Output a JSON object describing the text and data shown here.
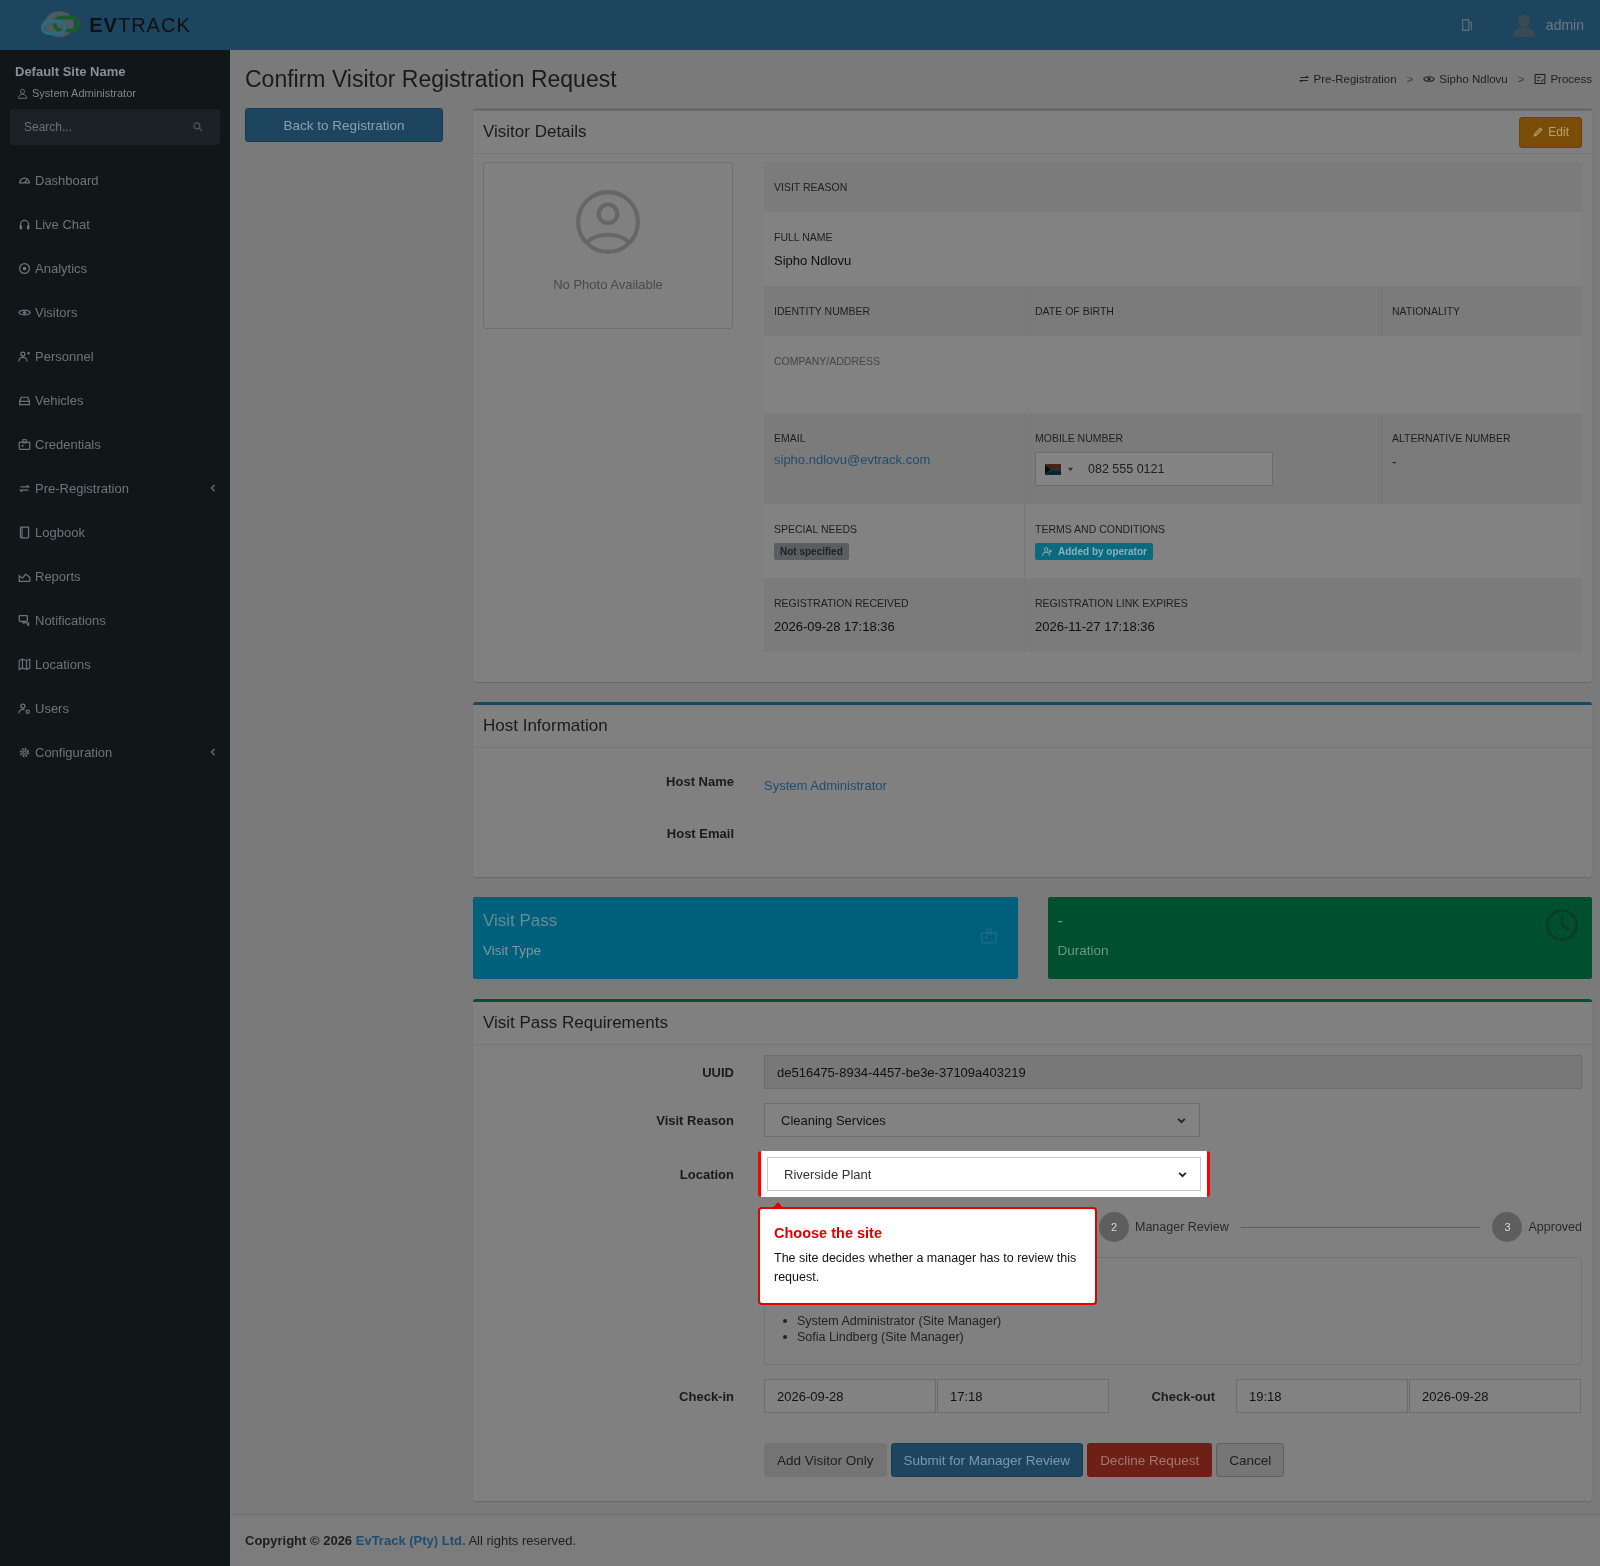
{
  "brand": {
    "logo": "**EV**TRACK"
  },
  "topbar": {
    "user": "admin"
  },
  "sidebar": {
    "site": "Default Site Name",
    "role": "System Administrator",
    "search": {
      "placeholder": "Search..."
    },
    "items": [
      {
        "label": "Dashboard",
        "expandable": false
      },
      {
        "label": "Live Chat",
        "expandable": false
      },
      {
        "label": "Analytics",
        "expandable": false
      },
      {
        "label": "Visitors",
        "expandable": false
      },
      {
        "label": "Personnel",
        "expandable": false
      },
      {
        "label": "Vehicles",
        "expandable": false
      },
      {
        "label": "Credentials",
        "expandable": false
      },
      {
        "label": "Pre-Registration",
        "expandable": true
      },
      {
        "label": "Logbook",
        "expandable": false
      },
      {
        "label": "Reports",
        "expandable": false
      },
      {
        "label": "Notifications",
        "expandable": false
      },
      {
        "label": "Locations",
        "expandable": false
      },
      {
        "label": "Users",
        "expandable": false
      },
      {
        "label": "Configuration",
        "expandable": true
      }
    ]
  },
  "page": {
    "title": "Confirm Visitor Registration Request",
    "back_button": "Back to Registration",
    "breadcrumb": {
      "separator": ">",
      "items": [
        {
          "label": "Pre-Registration"
        },
        {
          "label": "Sipho Ndlovu"
        },
        {
          "label": "Process"
        }
      ]
    }
  },
  "visitor_details": {
    "title": "Visitor Details",
    "edit_button": "Edit",
    "photo_text": "No Photo Available",
    "rows": [
      {
        "cells": [
          {
            "label": "VISIT REASON",
            "kind": "text"
          }
        ]
      },
      {
        "cells": [
          {
            "label": "FULL NAME",
            "value": "Sipho Ndlovu",
            "kind": "text"
          }
        ]
      },
      {
        "cells": [
          {
            "label": "IDENTITY NUMBER",
            "kind": "text"
          },
          {
            "label": "DATE OF BIRTH",
            "kind": "text"
          },
          {
            "label": "NATIONALITY",
            "kind": "text"
          }
        ]
      },
      {
        "cells": [
          {
            "label": "COMPANY/ADDRESS",
            "kind": "muted"
          }
        ]
      },
      {
        "cells": [
          {
            "label": "EMAIL",
            "value": "sipho.ndlovu@evtrack.com",
            "kind": "link"
          },
          {
            "label": "MOBILE NUMBER",
            "value": "082 555 0121",
            "kind": "phone"
          },
          {
            "label": "ALTERNATIVE NUMBER",
            "value": "-",
            "kind": "text"
          }
        ]
      },
      {
        "cells": [
          {
            "label": "SPECIAL NEEDS",
            "value": "Not specified",
            "kind": "tag"
          },
          {
            "label": "TERMS AND CONDITIONS",
            "value": "Added by operator",
            "kind": "operator-tag"
          }
        ]
      },
      {
        "cells": [
          {
            "label": "REGISTRATION RECEIVED",
            "value": "2026-09-28 17:18:36",
            "kind": "text"
          },
          {
            "label": "REGISTRATION LINK EXPIRES",
            "value": "2026-11-27 17:18:36",
            "kind": "text"
          }
        ]
      }
    ]
  },
  "host": {
    "title": "Host Information",
    "fields": [
      {
        "label": "Host Name",
        "value": "System Administrator"
      },
      {
        "label": "Host Email"
      }
    ]
  },
  "info_boxes": [
    {
      "value": "Visit Pass",
      "label": "Visit Type",
      "color": "#005f7a"
    },
    {
      "value": "-",
      "label": "Duration",
      "color": "#005030"
    }
  ],
  "requirements": {
    "title": "Visit Pass Requirements",
    "uuid": {
      "label": "UUID",
      "value": "de516475-8934-4457-be3e-37109a403219"
    },
    "visit_reason": {
      "label": "Visit Reason",
      "value": "Cleaning Services"
    },
    "location": {
      "label": "Location",
      "value": "Riverside Plant"
    },
    "steps": [
      {
        "number": "2",
        "label": "Manager Review"
      },
      {
        "number": "3",
        "label": "Approved"
      }
    ],
    "approvers": [
      "System Administrator (Site Manager)",
      "Sofia Lindberg (Site Manager)"
    ],
    "checkin": {
      "label": "Check-in",
      "date": "2026-09-28",
      "time": "17:18"
    },
    "checkout": {
      "label": "Check-out",
      "time": "19:18",
      "date": "2026-09-28"
    },
    "buttons": [
      {
        "label": "Add Visitor Only",
        "kind": "default"
      },
      {
        "label": "Submit for Manager Review",
        "kind": "primary"
      },
      {
        "label": "Decline Request",
        "kind": "danger"
      },
      {
        "label": "Cancel",
        "kind": "outline"
      }
    ]
  },
  "tooltip": {
    "title": "Choose the site",
    "text": "The site decides whether a manager has to review this request."
  },
  "footer": {
    "copyright": "Copyright © 2026",
    "company": "EvTrack (Pty) Ltd.",
    "rest": "All rights reserved."
  }
}
